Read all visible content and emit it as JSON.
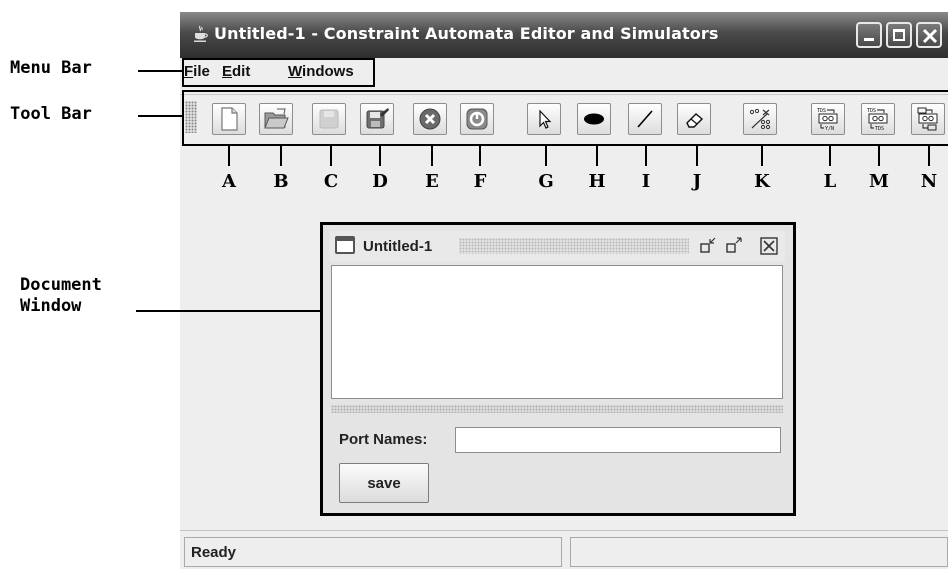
{
  "window": {
    "title": "Untitled-1 - Constraint Automata Editor and Simulators"
  },
  "menu_bar": {
    "items": [
      "File",
      "Edit",
      "Windows"
    ]
  },
  "toolbar": {
    "buttons": [
      {
        "letter": "A",
        "icon": "new-document-icon"
      },
      {
        "letter": "B",
        "icon": "open-folder-icon"
      },
      {
        "letter": "C",
        "icon": "save-disk-icon"
      },
      {
        "letter": "D",
        "icon": "save-as-icon"
      },
      {
        "letter": "E",
        "icon": "close-circle-icon"
      },
      {
        "letter": "F",
        "icon": "exit-circle-icon"
      },
      {
        "letter": "G",
        "icon": "select-arrow-icon"
      },
      {
        "letter": "H",
        "icon": "state-ellipse-icon"
      },
      {
        "letter": "I",
        "icon": "transition-line-icon"
      },
      {
        "letter": "J",
        "icon": "eraser-icon"
      },
      {
        "letter": "K",
        "icon": "layout-icon"
      },
      {
        "letter": "L",
        "icon": "simulator-tds-yn-icon"
      },
      {
        "letter": "M",
        "icon": "simulator-tds-to-tds-icon"
      },
      {
        "letter": "N",
        "icon": "simulator-icon"
      }
    ]
  },
  "document_window": {
    "title": "Untitled-1",
    "port_label": "Port Names:",
    "port_value": "",
    "save_label": "save"
  },
  "status_bar": {
    "text": "Ready"
  },
  "annotations": {
    "menu_bar": "Menu Bar",
    "tool_bar": "Tool Bar",
    "document_window": [
      "Document",
      "Window"
    ],
    "letters": [
      "A",
      "B",
      "C",
      "D",
      "E",
      "F",
      "G",
      "H",
      "I",
      "J",
      "K",
      "L",
      "M",
      "N"
    ]
  }
}
